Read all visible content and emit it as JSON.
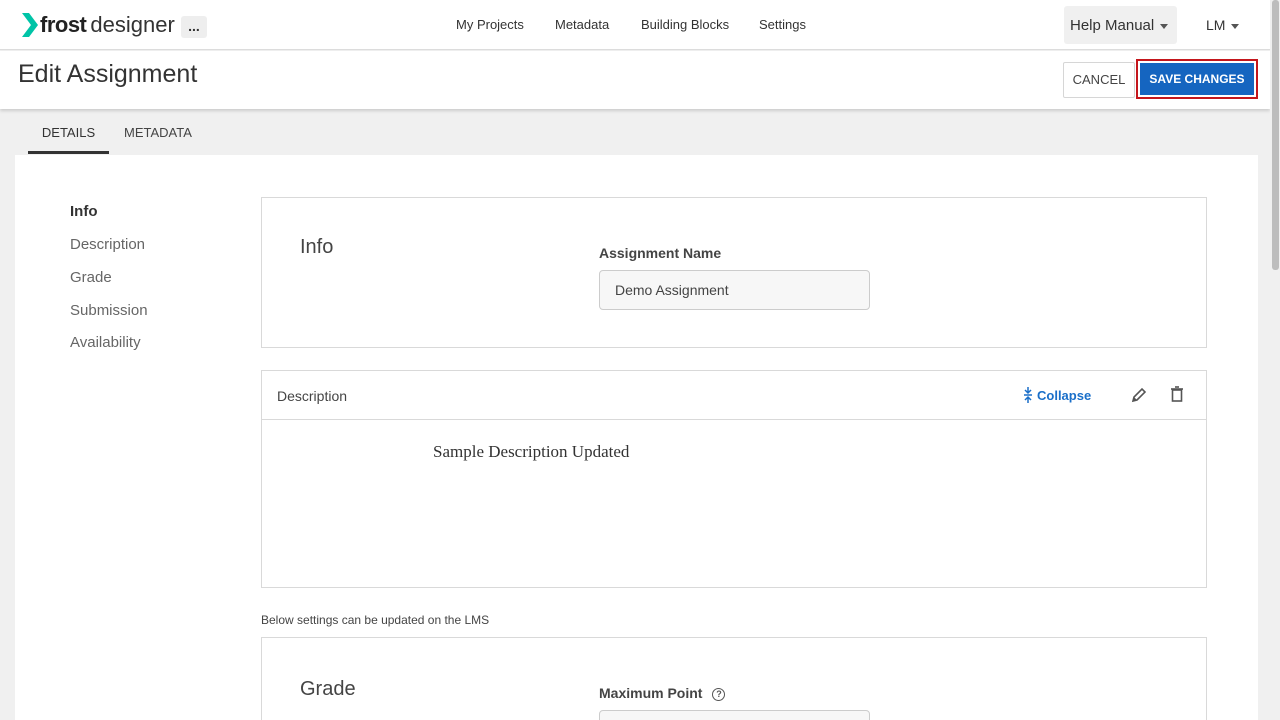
{
  "app": {
    "brand_bold": "frost",
    "brand_light": "designer",
    "more_label": "..."
  },
  "nav": {
    "my_projects": "My Projects",
    "metadata": "Metadata",
    "building_blocks": "Building Blocks",
    "settings": "Settings",
    "help": "Help Manual",
    "user": "LM"
  },
  "header": {
    "title": "Edit Assignment",
    "cancel": "CANCEL",
    "save": "SAVE CHANGES"
  },
  "tabs": [
    {
      "label": "DETAILS",
      "active": true
    },
    {
      "label": "METADATA",
      "active": false
    }
  ],
  "sidenav": [
    "Info",
    "Description",
    "Grade",
    "Submission",
    "Availability"
  ],
  "info": {
    "title": "Info",
    "name_label": "Assignment Name",
    "name_value": "Demo Assignment"
  },
  "description": {
    "title": "Description",
    "collapse": "Collapse",
    "body": "Sample Description Updated"
  },
  "lms_note": "Below settings can be updated on the LMS",
  "grade": {
    "title": "Grade",
    "max_point_label": "Maximum Point",
    "help_glyph": "?"
  },
  "colors": {
    "accent": "#1565c0",
    "brand": "#00c4a7",
    "highlight": "#c4161c",
    "link": "#1a6fc9"
  }
}
